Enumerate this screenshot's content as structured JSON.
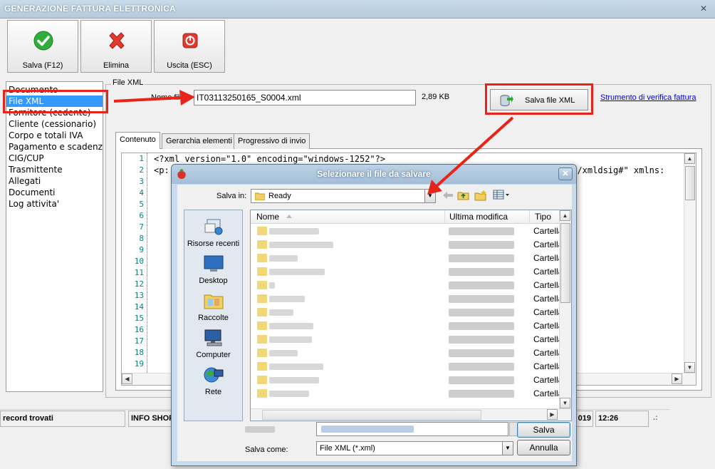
{
  "window": {
    "title": "GENERAZIONE FATTURA ELETTRONICA",
    "close_glyph": "✕"
  },
  "toolbar": {
    "save_label": "Salva (F12)",
    "delete_label": "Elimina",
    "exit_label": "Uscita (ESC)"
  },
  "sidebar": {
    "items": [
      {
        "label": "Documento"
      },
      {
        "label": "File XML"
      },
      {
        "label": "Fornitore (cedente)"
      },
      {
        "label": "Cliente (cessionario)"
      },
      {
        "label": "Corpo e totali IVA"
      },
      {
        "label": "Pagamento e scadenze"
      },
      {
        "label": "CIG/CUP"
      },
      {
        "label": "Trasmittente"
      },
      {
        "label": "Allegati"
      },
      {
        "label": "Documenti"
      },
      {
        "label": "Log attivita'"
      }
    ]
  },
  "file_xml": {
    "group_label": "File XML",
    "name_label": "Nome file",
    "name_value": "IT03113250165_S0004.xml",
    "size": "2,89 KB",
    "save_button_label": "Salva file XML",
    "verify_link": "Strumento di verifica fattura"
  },
  "tabs": [
    {
      "label": "Contenuto"
    },
    {
      "label": "Gerarchia elementi"
    },
    {
      "label": "Progressivo di invio"
    }
  ],
  "editor": {
    "line_numbers": [
      "1",
      "2",
      "3",
      "4",
      "5",
      "6",
      "7",
      "8",
      "9",
      "10",
      "11",
      "12",
      "13",
      "14",
      "15",
      "16",
      "17",
      "18",
      "19"
    ],
    "line1": "<?xml version=\"1.0\" encoding=\"windows-1252\"?>",
    "line2_start": "<p:",
    "line2_end": "09/xmldsig#\" xmlns:"
  },
  "statusbar": {
    "records": "record trovati",
    "info": "INFO SHOP",
    "date_partial": "019",
    "time": "12:26",
    "grip": ".:"
  },
  "dialog": {
    "title": "Selezionare il file da salvare",
    "close_glyph": "✕",
    "save_in_label": "Salva in:",
    "save_in_value": "Ready",
    "places": [
      {
        "label": "Risorse recenti",
        "icon": "recent-places-icon"
      },
      {
        "label": "Desktop",
        "icon": "desktop-icon"
      },
      {
        "label": "Raccolte",
        "icon": "libraries-icon"
      },
      {
        "label": "Computer",
        "icon": "computer-icon"
      },
      {
        "label": "Rete",
        "icon": "network-icon"
      }
    ],
    "columns": {
      "name": "Nome",
      "modified": "Ultima modifica",
      "type": "Tipo"
    },
    "rows": [
      {
        "type": "Cartella"
      },
      {
        "type": "Cartella"
      },
      {
        "type": "Cartella"
      },
      {
        "type": "Cartella"
      },
      {
        "type": "Cartella"
      },
      {
        "type": "Cartella"
      },
      {
        "type": "Cartella"
      },
      {
        "type": "Cartella"
      },
      {
        "type": "Cartella"
      },
      {
        "type": "Cartella"
      },
      {
        "type": "Cartella"
      },
      {
        "type": "Cartella"
      },
      {
        "type": "Cartella"
      }
    ],
    "save_as_label": "Salva come:",
    "save_as_value": "File XML (*.xml)",
    "save_button": "Salva",
    "cancel_button": "Annulla"
  },
  "colors": {
    "annotation_red": "#e8231a",
    "selection_blue": "#3399ff",
    "link_blue": "#0000cc"
  }
}
